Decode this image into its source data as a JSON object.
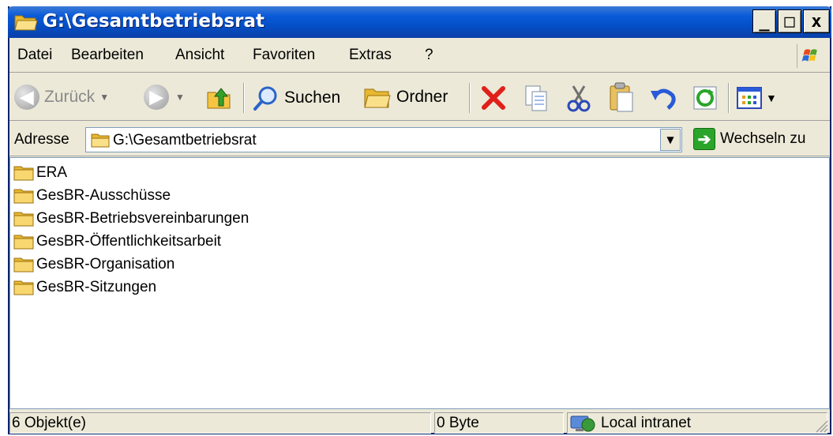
{
  "window": {
    "title": "G:\\Gesamtbetriebsrat",
    "minimize_glyph": "_",
    "maximize_glyph": "□",
    "close_glyph": "x"
  },
  "menu": {
    "items": [
      "Datei",
      "Bearbeiten",
      "Ansicht",
      "Favoriten",
      "Extras",
      "?"
    ]
  },
  "toolbar": {
    "back_label": "Zurück",
    "search_label": "Suchen",
    "folders_label": "Ordner",
    "icons": [
      "back-icon",
      "forward-icon",
      "up-folder-icon",
      "search-icon",
      "folders-icon",
      "delete-icon",
      "copy-to-icon",
      "cut-icon",
      "paste-icon",
      "undo-icon",
      "refresh-icon",
      "views-icon"
    ]
  },
  "address": {
    "label": "Adresse",
    "value": "G:\\Gesamtbetriebsrat",
    "go_label": "Wechseln zu"
  },
  "files": [
    {
      "name": "ERA"
    },
    {
      "name": "GesBR-Ausschüsse"
    },
    {
      "name": "GesBR-Betriebsvereinbarungen"
    },
    {
      "name": "GesBR-Öffentlichkeitsarbeit"
    },
    {
      "name": "GesBR-Organisation"
    },
    {
      "name": "GesBR-Sitzungen"
    }
  ],
  "status": {
    "objects": "6 Objekt(e)",
    "size": "0 Byte",
    "zone": "Local intranet"
  },
  "colors": {
    "titlebar": "#0a5ad8",
    "window_bg": "#ece9d8",
    "folder": "#f5c542",
    "delete_red": "#e0201a"
  }
}
